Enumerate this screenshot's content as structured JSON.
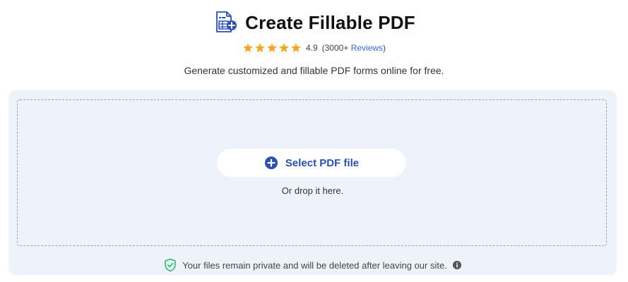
{
  "header": {
    "title": "Create Fillable PDF",
    "logo_icon": "fillable-pdf-document-icon"
  },
  "rating": {
    "stars": 5,
    "score": "4.9",
    "count_prefix": "(3000+ ",
    "reviews_link": "Reviews",
    "count_suffix": ")",
    "star_color": "#f5a623"
  },
  "subtitle": "Generate customized and fillable PDF forms online for free.",
  "upload": {
    "select_label": "Select PDF file",
    "select_icon": "plus-circle-icon",
    "drop_hint": "Or drop it here.",
    "accent": "#2a4fb5"
  },
  "privacy": {
    "text": "Your files remain private and will be deleted after leaving our site.",
    "shield_icon": "shield-check-icon",
    "info_icon": "info-icon"
  }
}
